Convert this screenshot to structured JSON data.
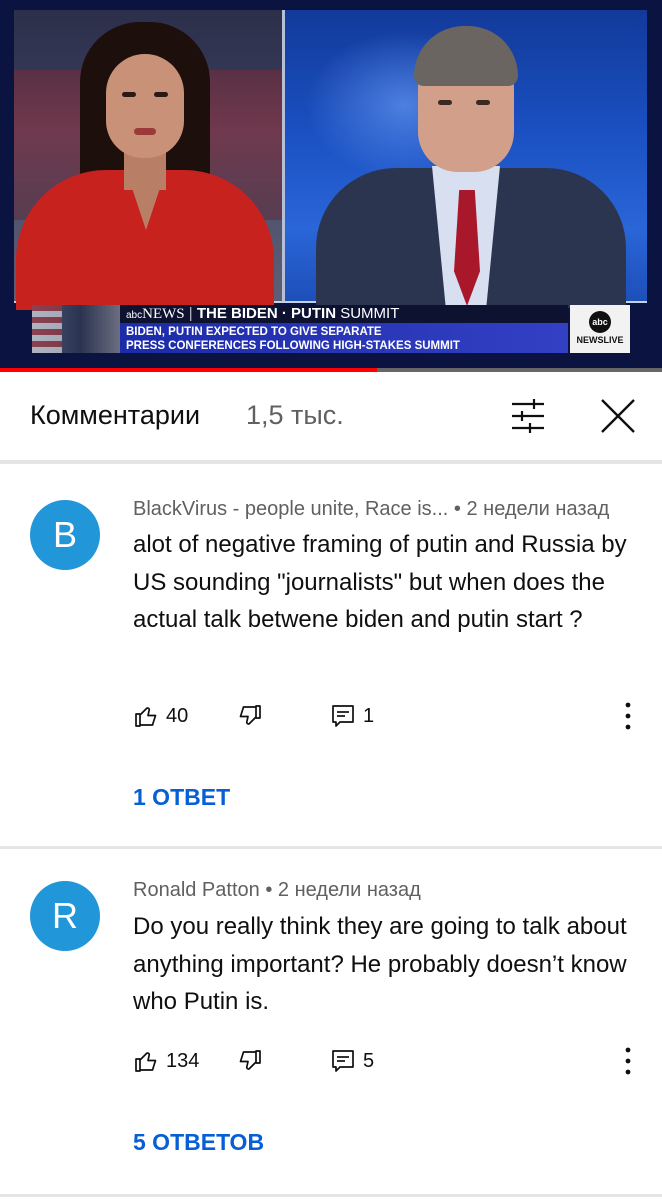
{
  "video": {
    "banner_brand": "NEWS",
    "banner_brand_prefix": "abc",
    "banner_show": "THE BIDEN · PUTIN SUMMIT",
    "banner_show_bold": "THE BIDEN · PUTIN",
    "banner_show_rest": " SUMMIT",
    "headline_line1": "BIDEN, PUTIN EXPECTED TO GIVE SEPARATE",
    "headline_line2": "PRESS CONFERENCES FOLLOWING HIGH-STAKES SUMMIT",
    "logo_circle": "abc",
    "logo_text": "NEWSLIVE",
    "progress_fraction": 0.57,
    "accent_color": "#ff0000"
  },
  "comments_header": {
    "title": "Комментарии",
    "count": "1,5 тыс.",
    "sort_icon": "sort-filter-icon",
    "close_icon": "close-icon"
  },
  "comments": [
    {
      "avatar_letter": "B",
      "avatar_color": "#2196d8",
      "author": "BlackVirus - people unite, Race is...",
      "time": "2 недели назад",
      "text": "alot of negative framing of putin and Russia by US sounding \"journalists\" but when does the actual talk betwene biden and putin start ?",
      "likes": "40",
      "reply_count": "1",
      "replies_label": "1 ОТВЕТ"
    },
    {
      "avatar_letter": "R",
      "avatar_color": "#2196d8",
      "author": "Ronald Patton",
      "time": "2 недели назад",
      "text": "Do you really think they are going to talk about anything important? He probably doesn’t know who Putin is.",
      "likes": "134",
      "reply_count": "5",
      "replies_label": "5 ОТВЕТОВ"
    }
  ]
}
